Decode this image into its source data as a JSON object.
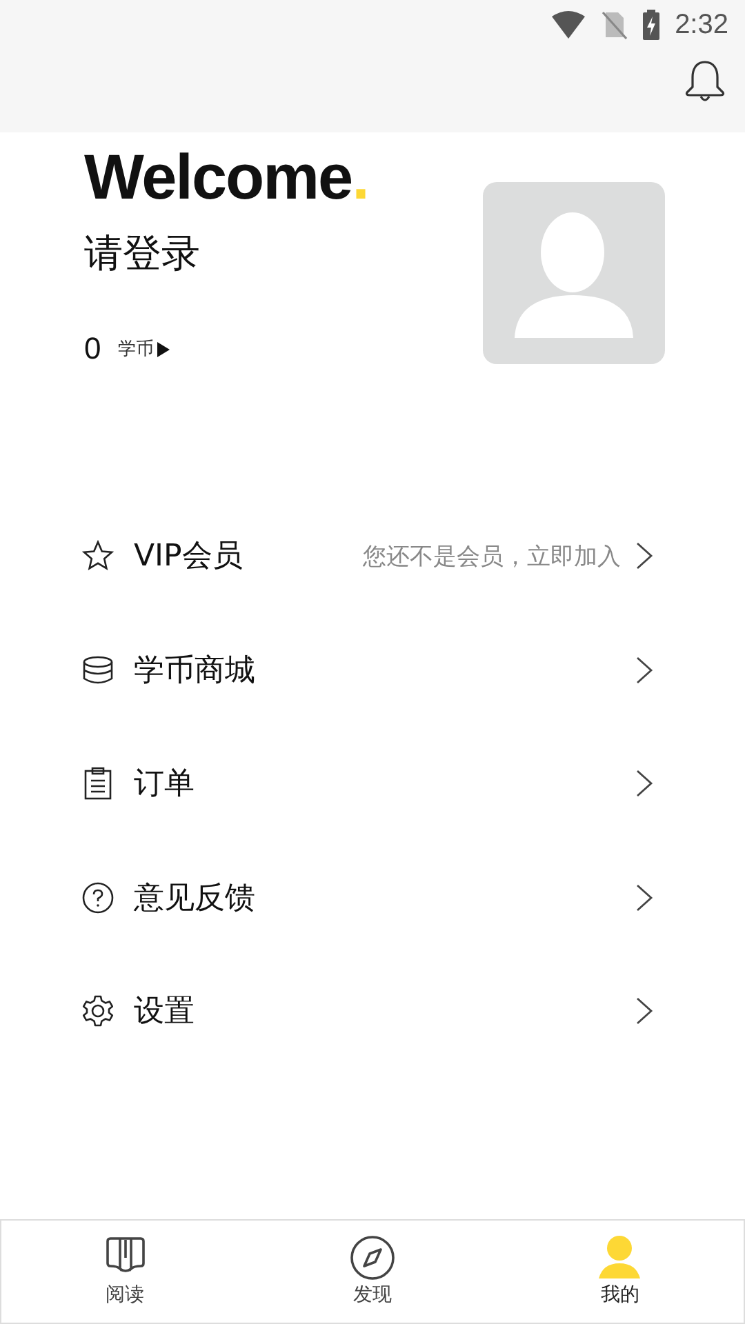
{
  "status_bar": {
    "time": "2:32"
  },
  "profile": {
    "title": "Welcome",
    "title_mark": ".",
    "login_prompt": "请登录",
    "coins": "0",
    "coins_label": "学币"
  },
  "menu": [
    {
      "kind": "vip",
      "label": "VIP会员",
      "hint": "您还不是会员，立即加入"
    },
    {
      "kind": "coins",
      "label": "学币商城"
    },
    {
      "kind": "orders",
      "label": "订单"
    },
    {
      "kind": "feedback",
      "label": "意见反馈"
    },
    {
      "kind": "settings",
      "label": "设置"
    }
  ],
  "tabs": [
    {
      "kind": "read",
      "label": "阅读",
      "selected": false
    },
    {
      "kind": "discover",
      "label": "发现",
      "selected": false
    },
    {
      "kind": "me",
      "label": "我的",
      "selected": true
    }
  ]
}
